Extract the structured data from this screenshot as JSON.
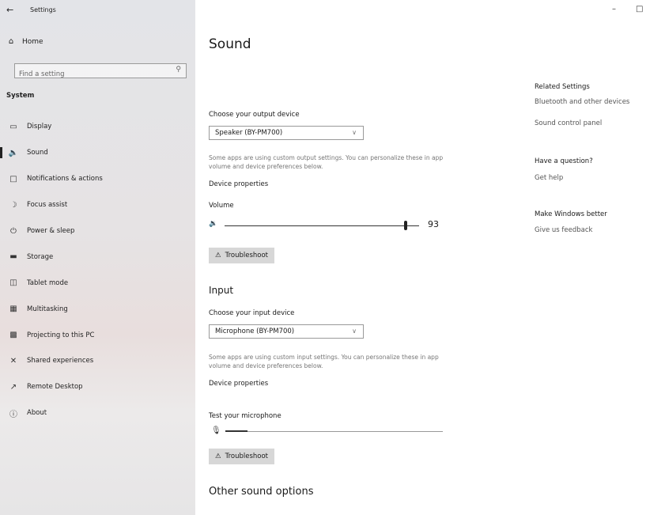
{
  "window": {
    "title": "Settings",
    "back_icon": "back-arrow-icon",
    "minimize_glyph": "–",
    "maximize_glyph": "□"
  },
  "sidebar": {
    "home_label": "Home",
    "search_placeholder": "Find a setting",
    "section_label": "System",
    "items": [
      {
        "label": "Display",
        "icon": "display-icon"
      },
      {
        "label": "Sound",
        "icon": "speaker-icon",
        "active": true
      },
      {
        "label": "Notifications & actions",
        "icon": "notifications-icon"
      },
      {
        "label": "Focus assist",
        "icon": "moon-icon"
      },
      {
        "label": "Power & sleep",
        "icon": "power-icon"
      },
      {
        "label": "Storage",
        "icon": "storage-icon"
      },
      {
        "label": "Tablet mode",
        "icon": "tablet-icon"
      },
      {
        "label": "Multitasking",
        "icon": "multitasking-icon"
      },
      {
        "label": "Projecting to this PC",
        "icon": "projecting-icon"
      },
      {
        "label": "Shared experiences",
        "icon": "shared-icon"
      },
      {
        "label": "Remote Desktop",
        "icon": "remote-desktop-icon"
      },
      {
        "label": "About",
        "icon": "info-icon"
      }
    ]
  },
  "main": {
    "title": "Sound",
    "output": {
      "choose_label": "Choose your output device",
      "device": "Speaker  (BY-PM700)",
      "description": "Some apps are using custom output settings. You can personalize these in app volume and device preferences below.",
      "device_properties": "Device properties",
      "volume_label": "Volume",
      "volume_value": "93",
      "volume_fraction": 0.93,
      "troubleshoot": "Troubleshoot"
    },
    "input": {
      "heading": "Input",
      "choose_label": "Choose your input device",
      "device": "Microphone  (BY-PM700)",
      "description": "Some apps are using custom input settings. You can personalize these in app volume and device preferences below.",
      "device_properties": "Device properties",
      "test_label": "Test your microphone",
      "mic_level_fraction": 0.1,
      "troubleshoot": "Troubleshoot"
    },
    "other_heading": "Other sound options"
  },
  "related": {
    "related_heading": "Related Settings",
    "bluetooth_link": "Bluetooth and other devices",
    "sound_panel_link": "Sound control panel",
    "question_heading": "Have a question?",
    "get_help": "Get help",
    "better_heading": "Make Windows better",
    "feedback_link": "Give us feedback"
  }
}
